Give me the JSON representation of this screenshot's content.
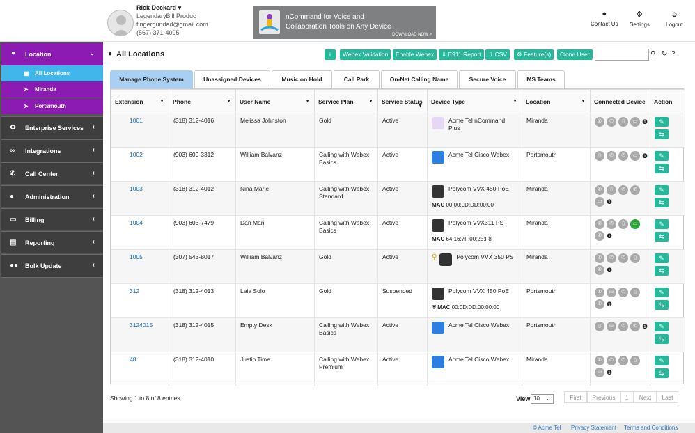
{
  "user": {
    "name": "Rick Deckard",
    "company": "LegendaryBill Produc",
    "email": "fingergundad@gmail.com",
    "phone": "(567) 371-4095"
  },
  "banner": {
    "line1": "nCommand for Voice and",
    "line2": "Collaboration Tools on Any Device",
    "download": "DOWNLOAD NOW >"
  },
  "topnav": {
    "contact": "Contact Us",
    "settings": "Settings",
    "logout": "Logout"
  },
  "sidebar": {
    "location": "Location",
    "subitems": [
      "All Locations",
      "Miranda",
      "Portsmouth"
    ],
    "items": [
      "Enterprise Services",
      "Integrations",
      "Call Center",
      "Administration",
      "Billing",
      "Reporting",
      "Bulk Update"
    ]
  },
  "page": {
    "title": "All Locations"
  },
  "toolbar": {
    "info": "i",
    "webex_validation": "Webex Validation",
    "enable_webex": "Enable Webex",
    "e911": "E911 Report",
    "csv": "CSV",
    "features": "Feature(s)",
    "clone_user": "Clone User"
  },
  "tabs": [
    "Manage Phone System",
    "Unassigned Devices",
    "Music on Hold",
    "Call Park",
    "On-Net Calling Name",
    "Secure Voice",
    "MS Teams"
  ],
  "table": {
    "headers": [
      "Extension",
      "Phone",
      "User Name",
      "Service Plan",
      "Service Status",
      "Device Type",
      "Location",
      "Connected Device",
      "Action"
    ],
    "rows": [
      {
        "ext": "1001",
        "phone": "(318) 312-4016",
        "user": "Melissa Johnston",
        "plan": "Gold",
        "status": "Active",
        "device": "Acme Tel nCommand Plus",
        "mac": "",
        "location": "Miranda"
      },
      {
        "ext": "1002",
        "phone": "(903) 609-3312",
        "user": "William Balvanz",
        "plan": "Calling with Webex Basics",
        "status": "Active",
        "device": "Acme Tel Cisco Webex",
        "mac": "",
        "location": "Portsmouth"
      },
      {
        "ext": "1003",
        "phone": "(318) 312-4012",
        "user": "Nina Marie",
        "plan": "Calling with Webex Standard",
        "status": "Active",
        "device": "Polycom VVX 450 PoE",
        "mac": "00:00:0D:DD:00:00",
        "location": "Miranda"
      },
      {
        "ext": "1004",
        "phone": "(903) 603-7479",
        "user": "Dan Man",
        "plan": "Calling with Webex Basics",
        "status": "Active",
        "device": "Polycom VVX311 PS",
        "mac": "64:16:7F:00:25:F8",
        "location": "Miranda"
      },
      {
        "ext": "1005",
        "phone": "(307) 543-8017",
        "user": "William Balvanz",
        "plan": "Gold",
        "status": "Active",
        "device": "Polycom VVX 350 PS",
        "mac": "",
        "location": "Miranda"
      },
      {
        "ext": "312",
        "phone": "(318) 312-4013",
        "user": "Leia Solo",
        "plan": "Gold",
        "status": "Suspended",
        "device": "Polycom VVX 450 PoE",
        "mac": "00:0D:DD:00:00:00",
        "location": "Portsmouth"
      },
      {
        "ext": "3124015",
        "phone": "(318) 312-4015",
        "user": "Empty Desk",
        "plan": "Calling with Webex Basics",
        "status": "Active",
        "device": "Acme Tel Cisco Webex",
        "mac": "",
        "location": "Portsmouth"
      },
      {
        "ext": "48",
        "phone": "(318) 312-4010",
        "user": "Justin Time",
        "plan": "Calling with Webex Premium",
        "status": "Active",
        "device": "Acme Tel Cisco Webex",
        "mac": "",
        "location": "Miranda"
      }
    ]
  },
  "mac_label": "MAC",
  "footer_info": {
    "showing": "Showing 1 to 8 of 8 entries",
    "view_label": "View",
    "view_value": "10"
  },
  "pagination": [
    "First",
    "Previous",
    "1",
    "Next",
    "Last"
  ],
  "footer": {
    "copyright": "© Acme Tel",
    "privacy": "Privacy Statement",
    "terms": "Terms and Conditions"
  }
}
